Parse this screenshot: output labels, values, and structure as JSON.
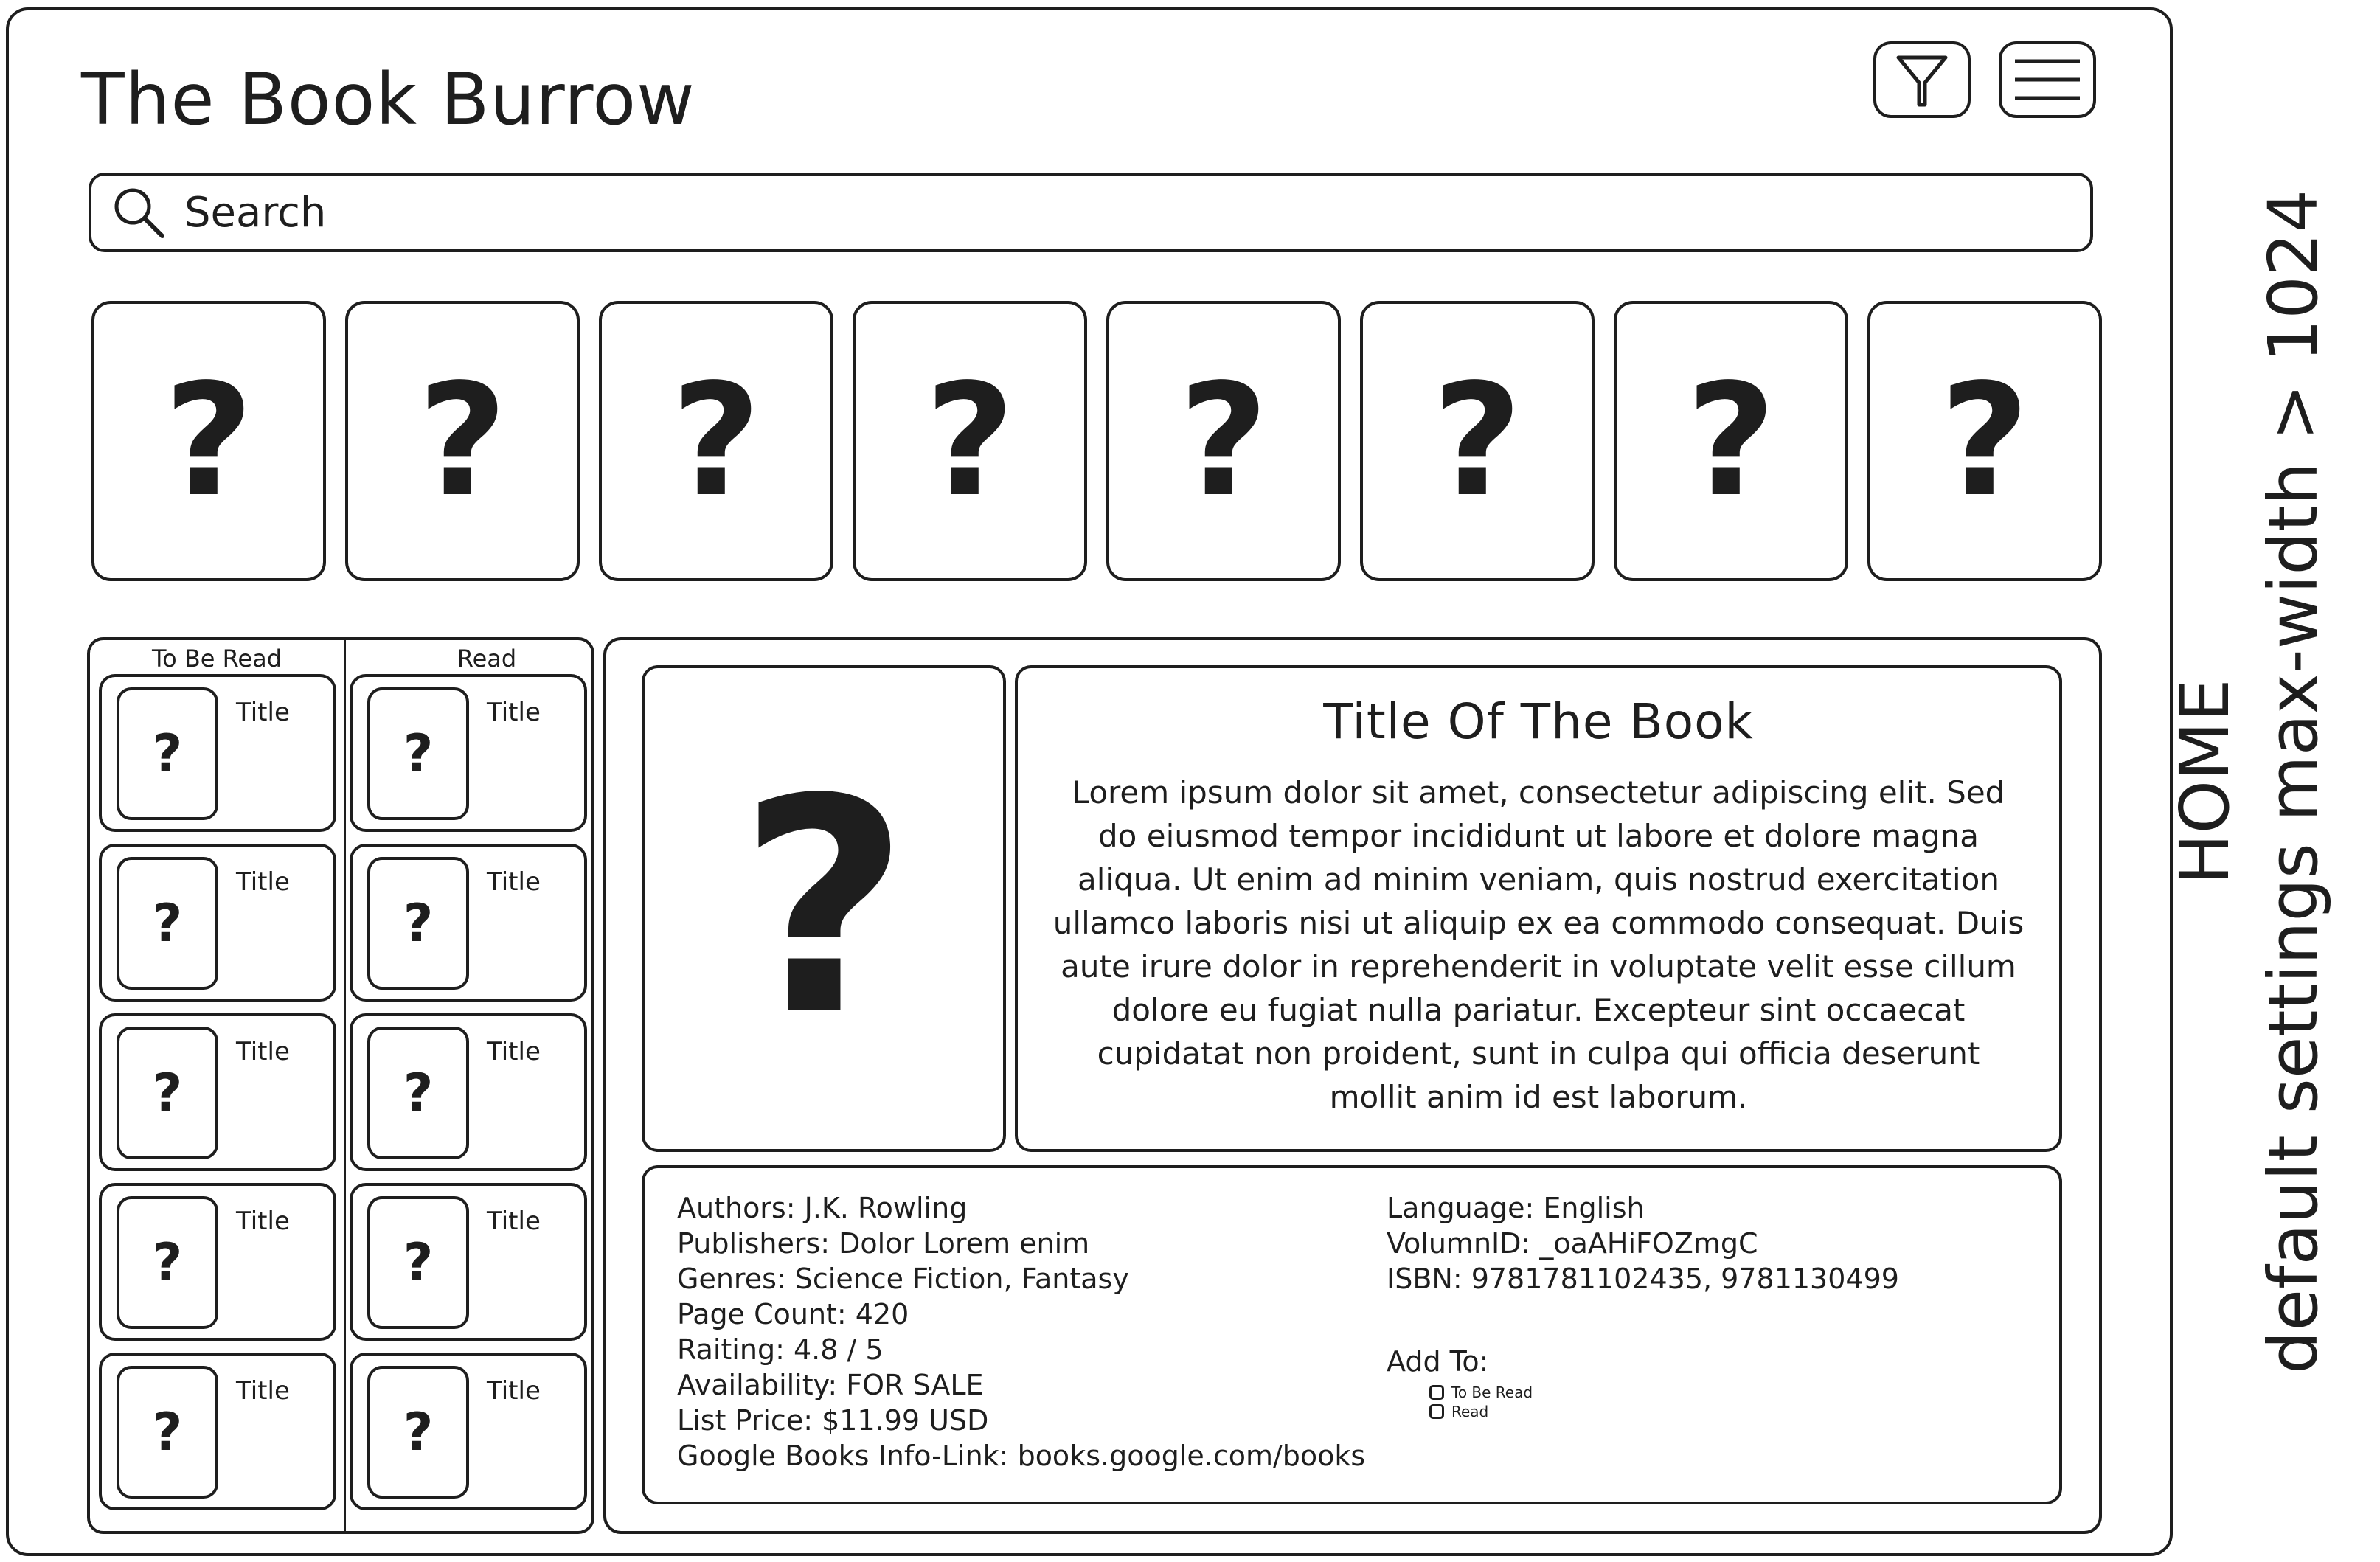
{
  "header": {
    "title": "The Book Burrow"
  },
  "toolbar": {
    "filter_icon": "filter-funnel-icon",
    "menu_icon": "hamburger-menu-icon"
  },
  "search": {
    "placeholder": "Search",
    "icon": "search-icon"
  },
  "carousel": {
    "items": [
      "?",
      "?",
      "?",
      "?",
      "?",
      "?",
      "?",
      "?"
    ]
  },
  "shelves": {
    "to_be_read": {
      "heading": "To Be Read",
      "items": [
        {
          "thumb": "?",
          "title": "Title"
        },
        {
          "thumb": "?",
          "title": "Title"
        },
        {
          "thumb": "?",
          "title": "Title"
        },
        {
          "thumb": "?",
          "title": "Title"
        },
        {
          "thumb": "?",
          "title": "Title"
        }
      ]
    },
    "read": {
      "heading": "Read",
      "items": [
        {
          "thumb": "?",
          "title": "Title"
        },
        {
          "thumb": "?",
          "title": "Title"
        },
        {
          "thumb": "?",
          "title": "Title"
        },
        {
          "thumb": "?",
          "title": "Title"
        },
        {
          "thumb": "?",
          "title": "Title"
        }
      ]
    }
  },
  "detail": {
    "cover": "?",
    "title": "Title Of The Book",
    "description": "Lorem ipsum dolor sit amet, consectetur adipiscing elit. Sed do eiusmod tempor incididunt ut labore et dolore magna aliqua. Ut enim ad minim veniam, quis nostrud exercitation ullamco laboris nisi ut aliquip ex ea commodo consequat. Duis aute irure dolor in reprehenderit in voluptate velit esse cillum dolore eu fugiat nulla pariatur. Excepteur sint occaecat cupidatat non proident, sunt in culpa qui officia deserunt mollit anim id est laborum.",
    "meta_left": [
      "Authors: J.K. Rowling",
      "Publishers: Dolor Lorem enim",
      "Genres: Science Fiction, Fantasy",
      "Page Count: 420",
      "Raiting: 4.8 / 5",
      "Availability: FOR SALE",
      "List Price: $11.99 USD",
      "Google Books Info-Link: books.google.com/books"
    ],
    "meta_right": [
      "Language: English",
      "VolumnID: _oaAHiFOZmgC",
      "ISBN: 9781781102435, 9781130499"
    ],
    "add_to": {
      "label": "Add To:",
      "options": [
        "To Be Read",
        "Read"
      ]
    }
  },
  "annotation": {
    "line1": "HOME",
    "line2": "default settings max-width > 1024"
  }
}
